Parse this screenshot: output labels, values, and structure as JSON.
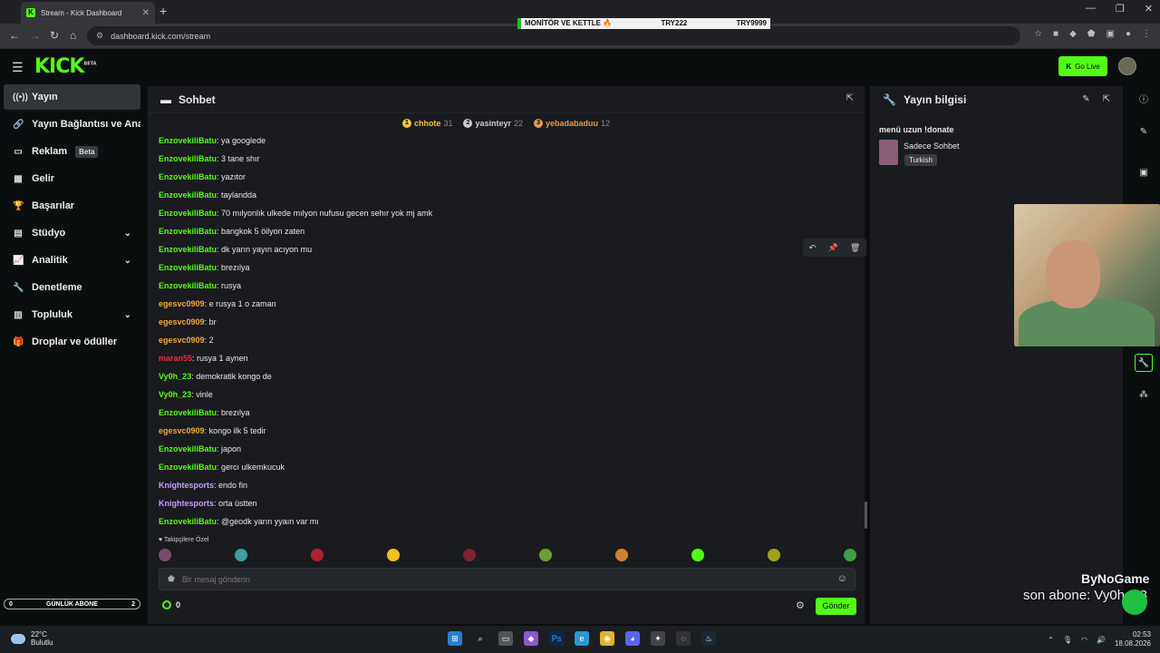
{
  "browser": {
    "tab_title": "Stream - Kick Dashboard",
    "url": "dashboard.kick.com/stream",
    "ticker": [
      "MONİTÖR VE KETTLE 🔥",
      "TRY222",
      "TRY9999"
    ]
  },
  "header": {
    "logo": "KICK",
    "logo_tag": "BETA",
    "golive": "Go Live"
  },
  "sidebar": {
    "items": [
      {
        "label": "Yayın",
        "icon": "broadcast-icon"
      },
      {
        "label": "Yayın Bağlantısı ve Anahtar",
        "icon": "link-icon"
      },
      {
        "label": "Reklam",
        "icon": "ad-icon",
        "badge": "Beta"
      },
      {
        "label": "Gelir",
        "icon": "revenue-icon"
      },
      {
        "label": "Başarılar",
        "icon": "trophy-icon"
      },
      {
        "label": "Stüdyo",
        "icon": "studio-icon"
      },
      {
        "label": "Analitik",
        "icon": "analytics-icon"
      },
      {
        "label": "Denetleme",
        "icon": "moderation-icon"
      },
      {
        "label": "Topluluk",
        "icon": "community-icon"
      },
      {
        "label": "Droplar ve ödüller",
        "icon": "drops-icon"
      }
    ],
    "sub_bar": {
      "left": "0",
      "label": "GÜNLÜK ABONE",
      "right": "2"
    }
  },
  "chat": {
    "title": "Sohbet",
    "top_gifters": [
      {
        "rank": "1",
        "name": "chhote",
        "count": "31",
        "color": "#f4c341"
      },
      {
        "rank": "2",
        "name": "yasinteyr",
        "count": "22",
        "color": "#c9c9c9"
      },
      {
        "rank": "3",
        "name": "yebadabaduu",
        "count": "12",
        "color": "#e09a55"
      }
    ],
    "messages": [
      {
        "user": "EnzovekiliBatu",
        "text": "ya googlede",
        "color": "#53fc18"
      },
      {
        "user": "EnzovekiliBatu",
        "text": "3 tane shır",
        "color": "#53fc18"
      },
      {
        "user": "EnzovekiliBatu",
        "text": "yazıtor",
        "color": "#53fc18"
      },
      {
        "user": "EnzovekiliBatu",
        "text": "taylandda",
        "color": "#53fc18"
      },
      {
        "user": "EnzovekiliBatu",
        "text": "70 mılyonlık ulkede mılyon nufusu gecen sehır yok mj amk",
        "color": "#53fc18"
      },
      {
        "user": "EnzovekiliBatu",
        "text": "bangkok 5 öilyon zaten",
        "color": "#53fc18"
      },
      {
        "user": "EnzovekiliBatu",
        "text": "dk yarın yayın acıyon mu",
        "color": "#53fc18"
      },
      {
        "user": "EnzovekiliBatu",
        "text": "brezılya",
        "color": "#53fc18"
      },
      {
        "user": "EnzovekiliBatu",
        "text": "rusya",
        "color": "#53fc18"
      },
      {
        "user": "egesvc0909",
        "text": "e rusya 1 o zaman",
        "color": "#f3a73b"
      },
      {
        "user": "egesvc0909",
        "text": "br",
        "color": "#f3a73b"
      },
      {
        "user": "egesvc0909",
        "text": "2",
        "color": "#f3a73b"
      },
      {
        "user": "maran55",
        "text": "rusya 1 aynen",
        "color": "#e5322f"
      },
      {
        "user": "Vy0h_23",
        "text": "demokratik kongo de",
        "color": "#53fc18"
      },
      {
        "user": "Vy0h_23",
        "text": "vinle",
        "color": "#53fc18"
      },
      {
        "user": "EnzovekiliBatu",
        "text": "brezılya",
        "color": "#53fc18"
      },
      {
        "user": "egesvc0909",
        "text": "kongo ilk 5 tedir",
        "color": "#f3a73b"
      },
      {
        "user": "EnzovekiliBatu",
        "text": "japon",
        "color": "#53fc18"
      },
      {
        "user": "EnzovekiliBatu",
        "text": "gercı ulkemkucuk",
        "color": "#53fc18"
      },
      {
        "user": "Knightesports",
        "text": "endo fin",
        "color": "#c79bff"
      },
      {
        "user": "Knightesports",
        "text": "orta üstten",
        "color": "#c79bff"
      },
      {
        "user": "EnzovekiliBatu",
        "text": "@geodk yarın yyaın var mı",
        "color": "#53fc18"
      }
    ],
    "followers_label": "Takipçilere Özel",
    "input_placeholder": "Bir mesaj gönderin",
    "points": "0",
    "send": "Gönder"
  },
  "info": {
    "title": "Yayın bilgisi",
    "stream_title": "menü uzun !donate",
    "category": "Sadece Sohbet",
    "language": "Turkish"
  },
  "overlay": {
    "brand": "ByNoGame",
    "last_sub": "son abone: Vy0h_23"
  },
  "taskbar": {
    "temp": "22°C",
    "weather": "Bulutlu",
    "time": "02:53",
    "date": "18.08.2026"
  }
}
